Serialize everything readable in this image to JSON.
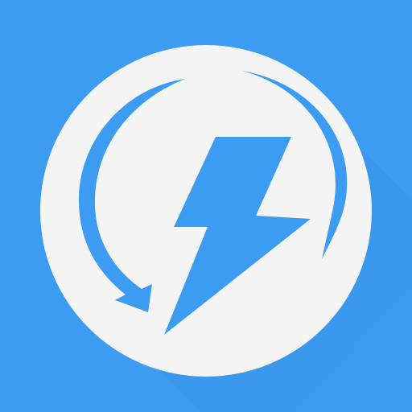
{
  "icon": {
    "name": "lightning-refresh-app-icon",
    "background_color": "#3C9CF2",
    "shadow_color": "#2F84D6",
    "badge_color": "#F4F4F4",
    "symbol_color": "#3C9CF2",
    "symbols": [
      "lightning-bolt-icon",
      "refresh-arrow-icon"
    ]
  }
}
